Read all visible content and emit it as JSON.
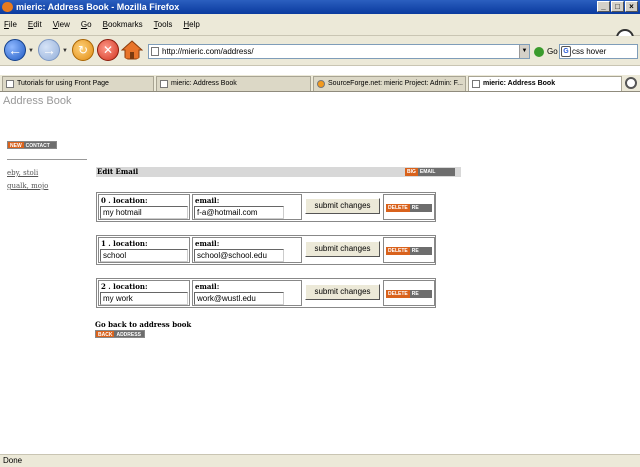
{
  "window": {
    "title": "mieric: Address Book - Mozilla Firefox",
    "buttons": [
      "_",
      "□",
      "×"
    ]
  },
  "menubar": {
    "items": [
      {
        "u": "F",
        "rest": "ile"
      },
      {
        "u": "E",
        "rest": "dit"
      },
      {
        "u": "V",
        "rest": "iew"
      },
      {
        "u": "G",
        "rest": "o"
      },
      {
        "u": "B",
        "rest": "ookmarks"
      },
      {
        "u": "T",
        "rest": "ools"
      },
      {
        "u": "H",
        "rest": "elp"
      }
    ]
  },
  "navbar": {
    "url": "http://mieric.com/address/",
    "go_label": "Go",
    "search_value": "css hover"
  },
  "tabs": [
    {
      "label": "Tutorials for using Front Page",
      "active": false
    },
    {
      "label": "mieric: Address Book",
      "active": false
    },
    {
      "label": "SourceForge.net: mieric Project: Admin: F...",
      "active": false
    },
    {
      "label": "mieric: Address Book",
      "active": true
    }
  ],
  "page": {
    "heading": "Address Book",
    "new_contact": {
      "a": "NEW",
      "b": "CONTACT"
    },
    "sidebar_links": [
      "eby, stoli",
      "gualk, mojo"
    ],
    "edit_title": "Edit Email",
    "big_email": {
      "a": "BIG",
      "b": "EMAIL"
    },
    "rows": [
      {
        "location_label": "0 . location:",
        "email_label": "email:",
        "location": "my hotmail",
        "email": "f-a@hotmail.com"
      },
      {
        "location_label": "1 . location:",
        "email_label": "email:",
        "location": "school",
        "email": "school@school.edu"
      },
      {
        "location_label": "2 . location:",
        "email_label": "email:",
        "location": "my work",
        "email": "work@wustl.edu"
      }
    ],
    "submit_label": "submit changes",
    "delete_btn": {
      "a": "DELETE",
      "b": "RE"
    },
    "go_back": "Go back to address book",
    "back_btn": {
      "a": "BACK",
      "b": "ADDRESS"
    }
  },
  "statusbar": {
    "text": "Done"
  }
}
